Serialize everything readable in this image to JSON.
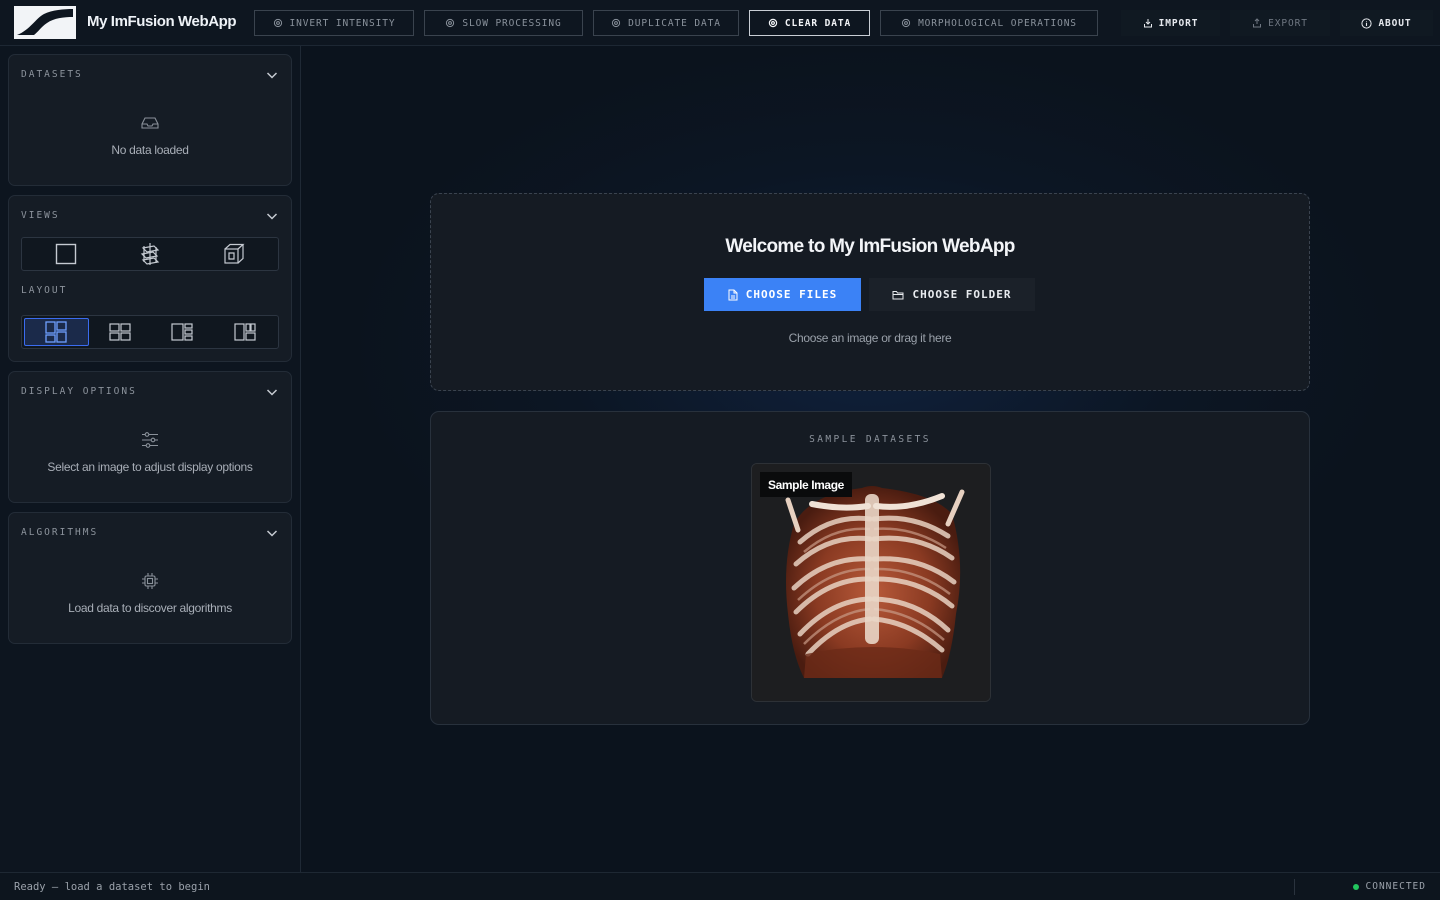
{
  "app": {
    "title": "My ImFusion WebApp"
  },
  "toolbar": {
    "algorithms": [
      {
        "label": "INVERT INTENSITY",
        "active": false
      },
      {
        "label": "SLOW PROCESSING",
        "active": false
      },
      {
        "label": "DUPLICATE DATA",
        "active": false
      },
      {
        "label": "CLEAR DATA",
        "active": true
      },
      {
        "label": "MORPHOLOGICAL OPERATIONS",
        "active": false
      }
    ],
    "import_label": "IMPORT",
    "export_label": "EXPORT",
    "about_label": "ABOUT"
  },
  "sidebar": {
    "datasets": {
      "title": "DATASETS",
      "empty_text": "No data loaded",
      "icon": "inbox-icon"
    },
    "views": {
      "title": "VIEWS",
      "view_icons": [
        "single-view-icon",
        "slice-3d-icon",
        "volume-cube-icon"
      ],
      "layout_title": "LAYOUT",
      "layout_icons": [
        "layout-main-left-icon",
        "layout-grid-icon",
        "layout-main-right-icon",
        "layout-column-icon"
      ],
      "selected_layout_index": 0
    },
    "display_options": {
      "title": "DISPLAY OPTIONS",
      "empty_text": "Select an image to adjust display options",
      "icon": "sliders-icon"
    },
    "algorithms": {
      "title": "ALGORITHMS",
      "empty_text": "Load data to discover algorithms",
      "icon": "chip-icon"
    }
  },
  "main": {
    "welcome_title": "Welcome to My ImFusion WebApp",
    "choose_files_label": "CHOOSE FILES",
    "choose_folder_label": "CHOOSE FOLDER",
    "hint": "Choose an image or drag it here",
    "samples_title": "SAMPLE DATASETS",
    "samples": [
      {
        "label": "Sample Image"
      }
    ]
  },
  "status": {
    "text": "Ready — load a dataset to begin",
    "connection": "CONNECTED",
    "connection_color": "#22c55e"
  },
  "colors": {
    "accent": "#3b82f6",
    "background": "#0c141f",
    "panel": "#151c25"
  }
}
